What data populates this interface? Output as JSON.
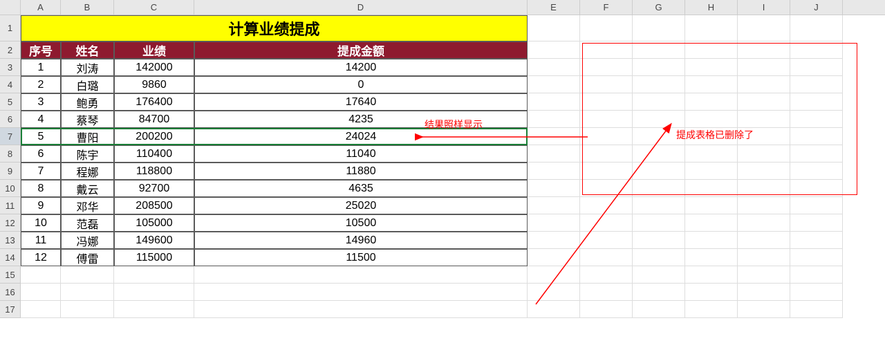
{
  "columns": [
    "A",
    "B",
    "C",
    "D",
    "E",
    "F",
    "G",
    "H",
    "I",
    "J"
  ],
  "title": "计算业绩提成",
  "headers": {
    "seq": "序号",
    "name": "姓名",
    "perf": "业绩",
    "comm": "提成金额"
  },
  "rows": [
    {
      "seq": 1,
      "name": "刘涛",
      "perf": 142000,
      "comm": 14200
    },
    {
      "seq": 2,
      "name": "白璐",
      "perf": 9860,
      "comm": 0
    },
    {
      "seq": 3,
      "name": "鲍勇",
      "perf": 176400,
      "comm": 17640
    },
    {
      "seq": 4,
      "name": "蔡琴",
      "perf": 84700,
      "comm": 4235
    },
    {
      "seq": 5,
      "name": "曹阳",
      "perf": 200200,
      "comm": 24024
    },
    {
      "seq": 6,
      "name": "陈宇",
      "perf": 110400,
      "comm": 11040
    },
    {
      "seq": 7,
      "name": "程娜",
      "perf": 118800,
      "comm": 11880
    },
    {
      "seq": 8,
      "name": "戴云",
      "perf": 92700,
      "comm": 4635
    },
    {
      "seq": 9,
      "name": "邓华",
      "perf": 208500,
      "comm": 25020
    },
    {
      "seq": 10,
      "name": "范磊",
      "perf": 105000,
      "comm": 10500
    },
    {
      "seq": 11,
      "name": "冯娜",
      "perf": 149600,
      "comm": 14960
    },
    {
      "seq": 12,
      "name": "傅雷",
      "perf": 115000,
      "comm": 11500
    }
  ],
  "selected_row": 7,
  "annotations": {
    "arrow_label": "结果照样显示",
    "box_label": "提成表格已删除了"
  },
  "chart_data": {
    "type": "table",
    "title": "计算业绩提成",
    "columns": [
      "序号",
      "姓名",
      "业绩",
      "提成金额"
    ],
    "data": [
      [
        1,
        "刘涛",
        142000,
        14200
      ],
      [
        2,
        "白璐",
        9860,
        0
      ],
      [
        3,
        "鲍勇",
        176400,
        17640
      ],
      [
        4,
        "蔡琴",
        84700,
        4235
      ],
      [
        5,
        "曹阳",
        200200,
        24024
      ],
      [
        6,
        "陈宇",
        110400,
        11040
      ],
      [
        7,
        "程娜",
        118800,
        11880
      ],
      [
        8,
        "戴云",
        92700,
        4635
      ],
      [
        9,
        "邓华",
        208500,
        25020
      ],
      [
        10,
        "范磊",
        105000,
        10500
      ],
      [
        11,
        "冯娜",
        149600,
        14960
      ],
      [
        12,
        "傅雷",
        115000,
        11500
      ]
    ]
  }
}
